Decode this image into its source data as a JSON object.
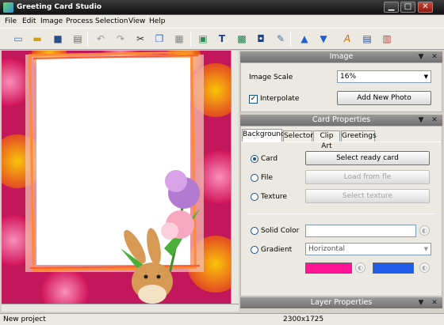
{
  "window": {
    "title": "Greeting Card Studio",
    "minimize": "▁",
    "maximize": "□",
    "close": "✕"
  },
  "menu": [
    "File",
    "Edit",
    "Image",
    "Process",
    "Selection",
    "View",
    "Help"
  ],
  "toolbar_icons": [
    "new-icon",
    "open-icon",
    "save-icon",
    "print-icon",
    "undo-icon",
    "redo-icon",
    "cut-icon",
    "copy-icon",
    "paste-icon",
    "insert-image-icon",
    "insert-text-icon",
    "insert-shape-icon",
    "frame-icon",
    "brush-icon",
    "bring-forward-icon",
    "send-backward-icon",
    "text-style-icon",
    "page-icon",
    "export-icon"
  ],
  "image_panel": {
    "title": "Image",
    "scale_label": "Image Scale",
    "scale_value": "16%",
    "interpolate_label": "Interpolate",
    "interpolate_checked": true,
    "add_photo_label": "Add New Photo"
  },
  "card_panel": {
    "title": "Card Properties",
    "tabs": [
      "Background",
      "Selector",
      "Clip Art",
      "Greetings"
    ],
    "card_label": "Card",
    "select_ready_card": "Select ready card",
    "file_label": "File",
    "load_from_file": "Load from fle",
    "texture_label": "Texture",
    "select_texture": "Select texture",
    "solid_color_label": "Solid Color",
    "gradient_label": "Gradient",
    "gradient_type": "Horizontal",
    "gradient_color1": "#ff1493",
    "gradient_color2": "#1e5be8"
  },
  "layer_panel": {
    "title": "Layer Properties"
  },
  "status": {
    "left": "New project",
    "dimensions": "2300x1725"
  },
  "colors": {
    "accent_magenta": "#ff1493",
    "accent_blue": "#1e5be8",
    "panel_head": "#808080"
  }
}
